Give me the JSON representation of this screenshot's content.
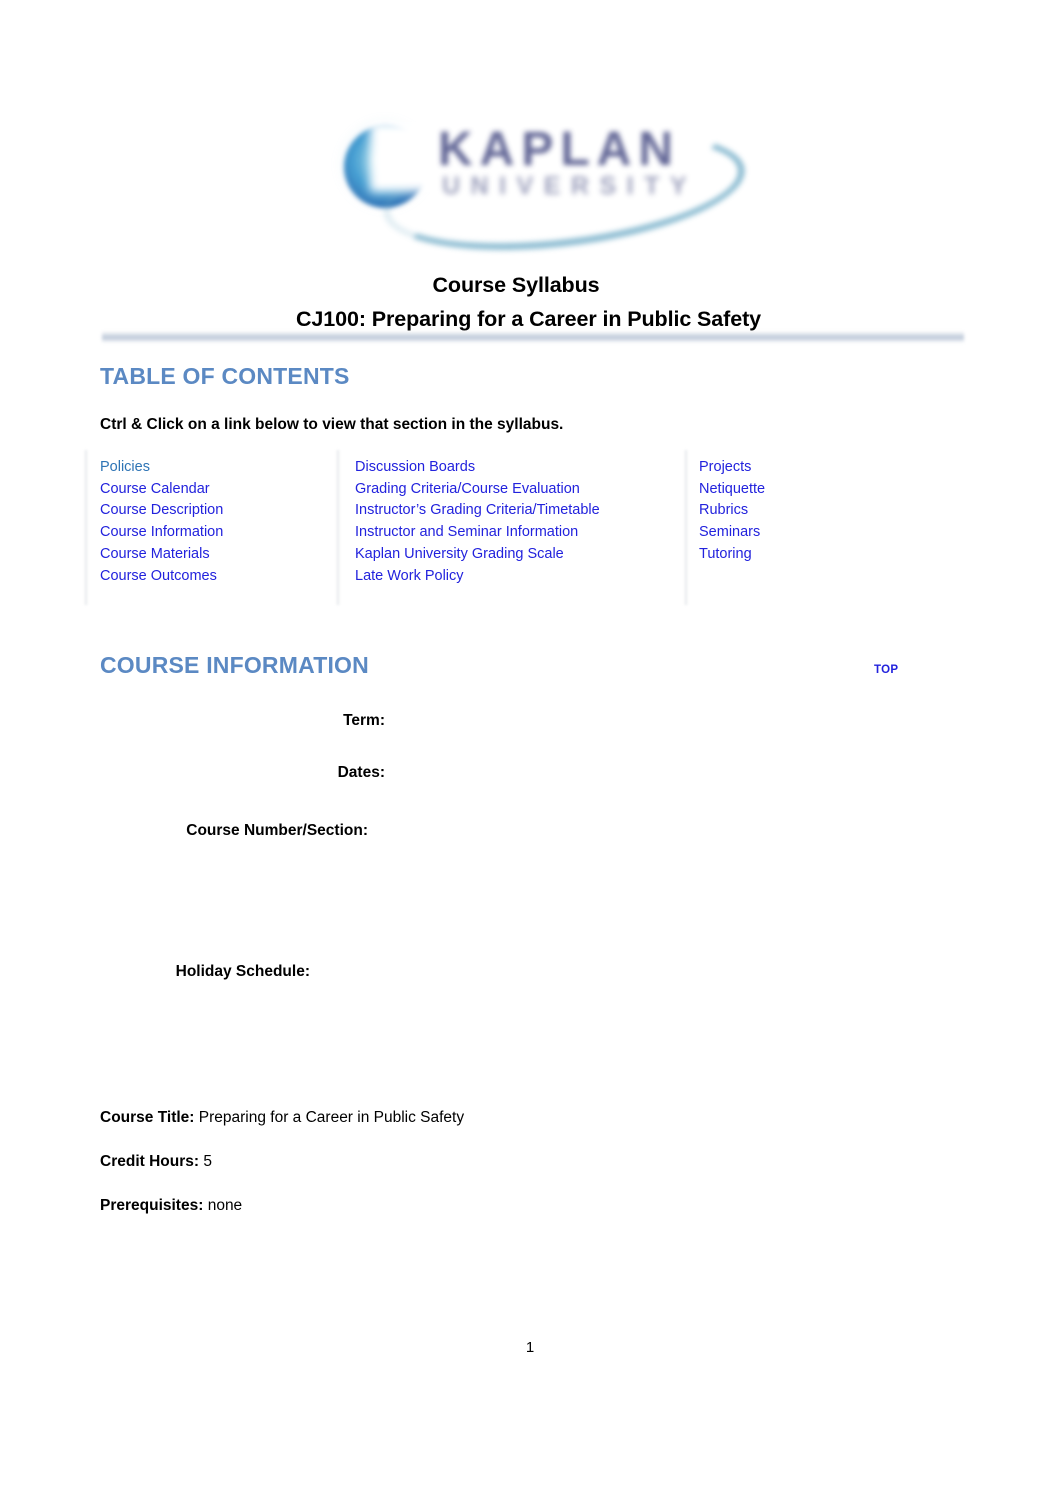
{
  "logo": {
    "brand": "KAPLAN",
    "subbrand": "UNIVERSITY",
    "globe_icon": "globe-icon",
    "swoosh_icon": "swoosh-arc-icon",
    "colors": {
      "globe_center": "#cfe9f3",
      "globe_edge": "#2b5ea6",
      "wordmark": "#4a4f86",
      "swoosh": "#6aa8c4"
    }
  },
  "title": {
    "line1": "Course Syllabus",
    "line2": "CJ100: Preparing for a Career in Public Safety"
  },
  "colors": {
    "heading_blue": "#5b89c3",
    "link_blue": "#2222dd",
    "link_blue_alt": "#2e74b5",
    "rule_gray": "#b0bed1"
  },
  "toc": {
    "heading": "TABLE OF CONTENTS",
    "instruction": "Ctrl & Click on a link below to view that section in the syllabus.",
    "columns": [
      {
        "links": [
          {
            "label": "Policies",
            "style": "alt"
          },
          {
            "label": "Course Calendar",
            "style": "default"
          },
          {
            "label": "Course Description",
            "style": "default"
          },
          {
            "label": "Course Information",
            "style": "default"
          },
          {
            "label": "Course Materials",
            "style": "default"
          },
          {
            "label": "Course Outcomes",
            "style": "default"
          }
        ]
      },
      {
        "links": [
          {
            "label": "Discussion Boards",
            "style": "default"
          },
          {
            "label": "Grading Criteria/Course Evaluation",
            "style": "default"
          },
          {
            "label": "Instructor’s Grading Criteria/Timetable",
            "style": "default"
          },
          {
            "label": "Instructor and Seminar Information",
            "style": "default"
          },
          {
            "label": "Kaplan University Grading Scale",
            "style": "default"
          },
          {
            "label": "Late Work Policy",
            "style": "default"
          }
        ]
      },
      {
        "links": [
          {
            "label": "Projects",
            "style": "default"
          },
          {
            "label": "Netiquette",
            "style": "default"
          },
          {
            "label": "Rubrics",
            "style": "default"
          },
          {
            "label": "Seminars",
            "style": "default"
          },
          {
            "label": "Tutoring",
            "style": "default"
          }
        ]
      }
    ]
  },
  "course_information": {
    "heading": "COURSE INFORMATION",
    "top_link": "TOP",
    "fields": [
      {
        "label": "Term:",
        "value": ""
      },
      {
        "label": "Dates:",
        "value": ""
      },
      {
        "label": "Course Number/Section:",
        "value": ""
      },
      {
        "label": "Holiday Schedule:",
        "value": ""
      }
    ],
    "details": [
      {
        "label": "Course Title:",
        "value": " Preparing for a Career in Public Safety"
      },
      {
        "label": "Credit Hours:",
        "value": " 5"
      },
      {
        "label": "Prerequisites:",
        "value": " none"
      }
    ]
  },
  "footer": {
    "page_number": "1"
  }
}
